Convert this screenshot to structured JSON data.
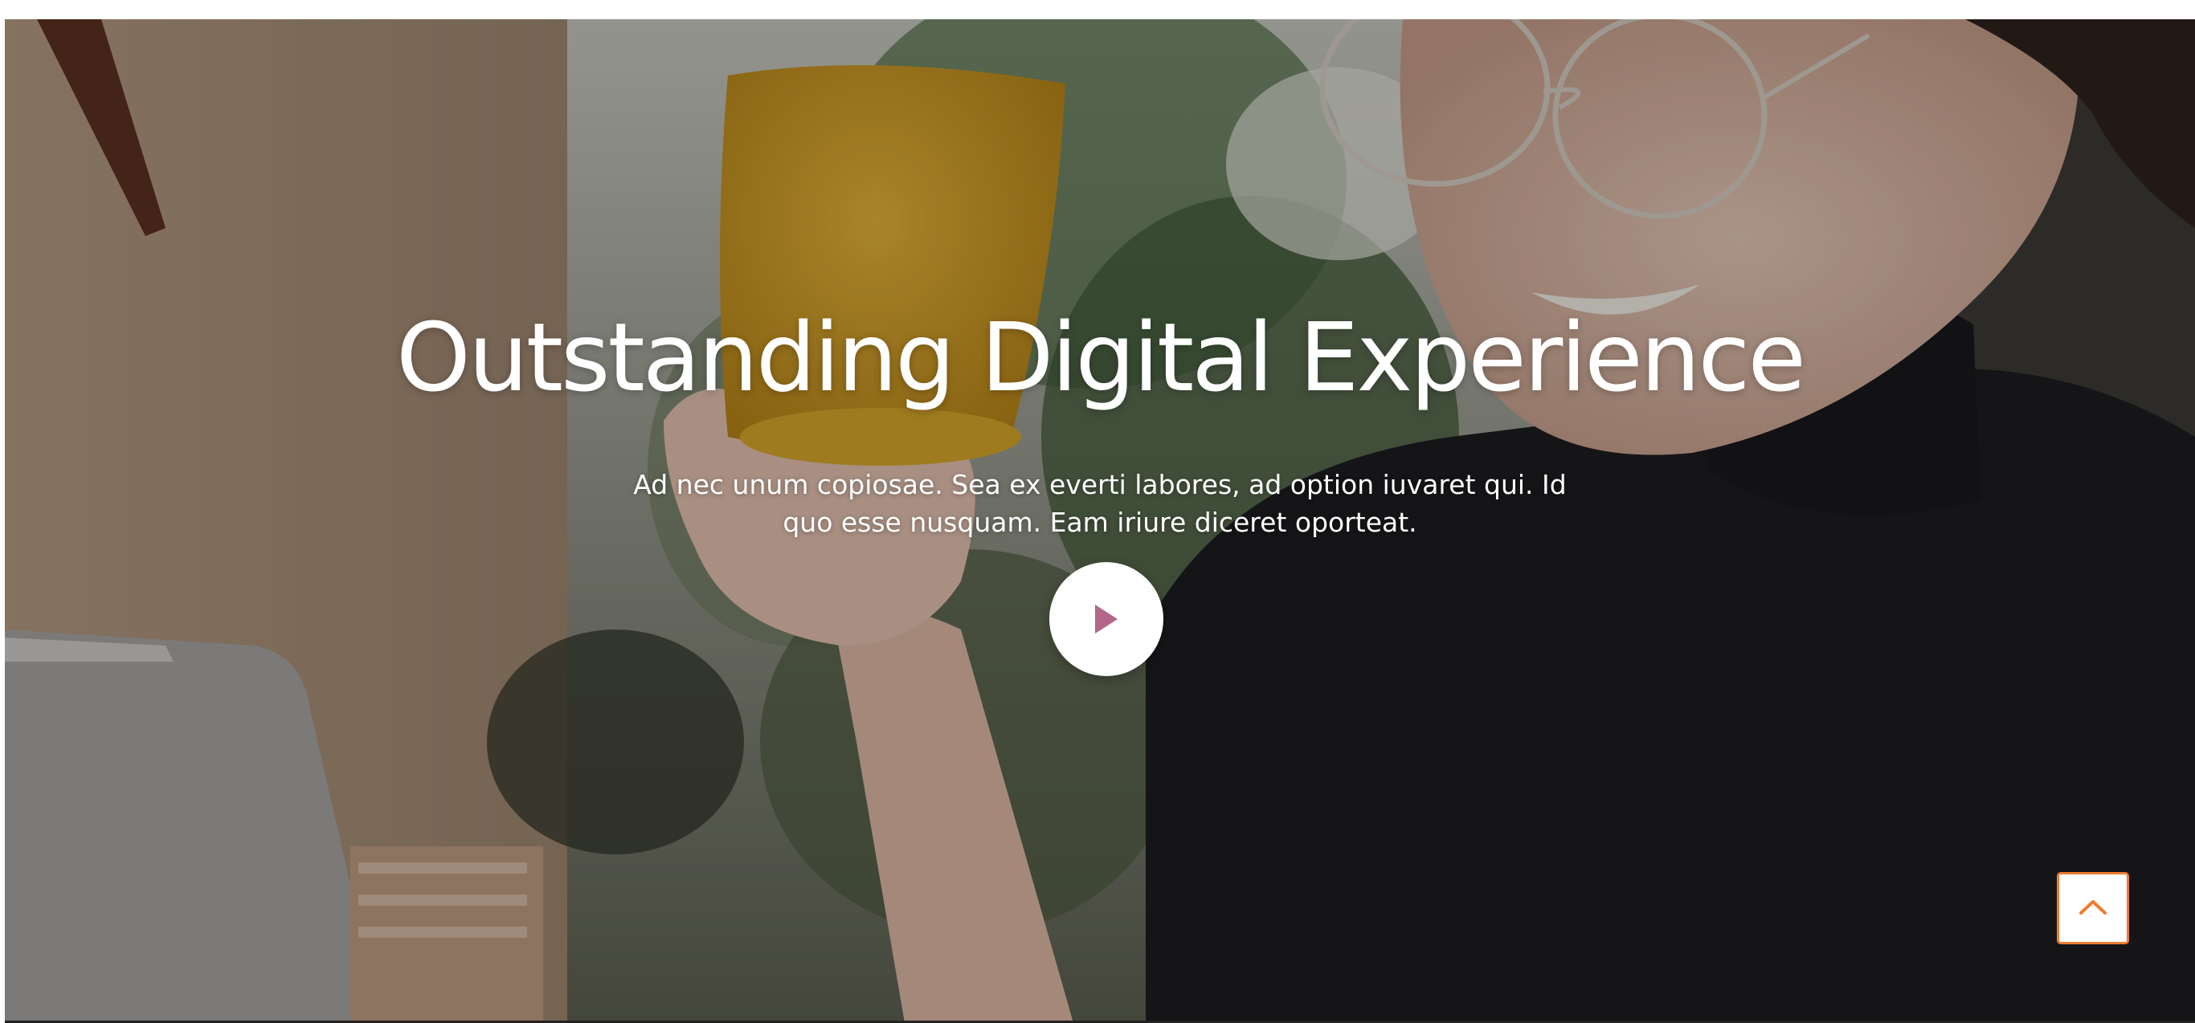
{
  "hero": {
    "title": "Outstanding Digital Experience",
    "subtitle_line1": "Ad nec unum copiosae. Sea ex everti labores, ad option iuvaret qui. Id",
    "subtitle_line2": "quo esse nusquam. Eam iriure diceret oporteat.",
    "play_icon": "play-icon",
    "background": "photo-woman-with-yellow-mug"
  },
  "scroll_top": {
    "icon": "chevron-up-icon"
  },
  "colors": {
    "accent": "#f07c30",
    "play_icon": "#b3668a",
    "title_text": "#ffffff"
  }
}
